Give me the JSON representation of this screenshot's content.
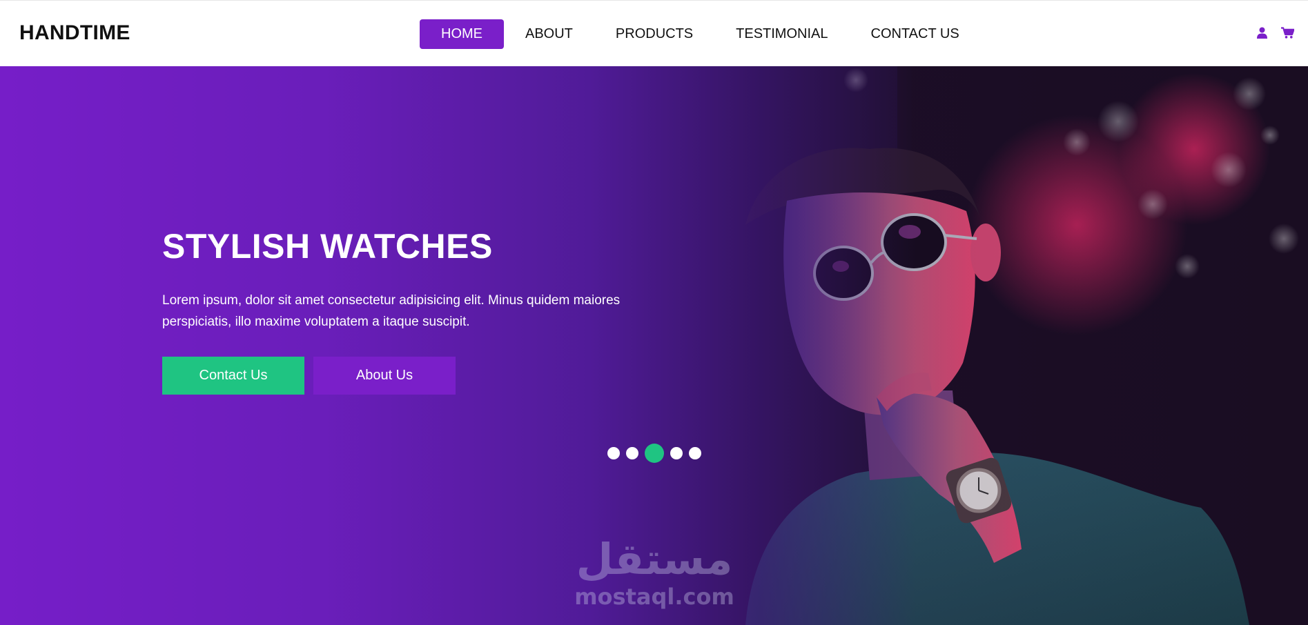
{
  "header": {
    "brand": "HANDTIME",
    "nav": [
      {
        "label": "HOME",
        "active": true
      },
      {
        "label": "ABOUT",
        "active": false
      },
      {
        "label": "PRODUCTS",
        "active": false
      },
      {
        "label": "TESTIMONIAL",
        "active": false
      },
      {
        "label": "CONTACT US",
        "active": false
      }
    ],
    "icons": [
      "user-icon",
      "cart-icon"
    ]
  },
  "hero": {
    "title": "STYLISH WATCHES",
    "text_line1": "Lorem ipsum, dolor sit amet consectetur adipisicing elit. Minus quidem maiores",
    "text_line2": "perspiciatis, illo maxime voluptatem a itaque suscipit.",
    "contact_button": "Contact Us",
    "about_button": "About Us",
    "slider": {
      "count": 5,
      "active_index": 2
    }
  },
  "watermark": {
    "arabic": "مستقل",
    "latin": "mostaql.com"
  },
  "colors": {
    "accent_purple": "#7a1fc9",
    "accent_green": "#1fc482",
    "text_dark": "#111111",
    "white": "#ffffff"
  }
}
